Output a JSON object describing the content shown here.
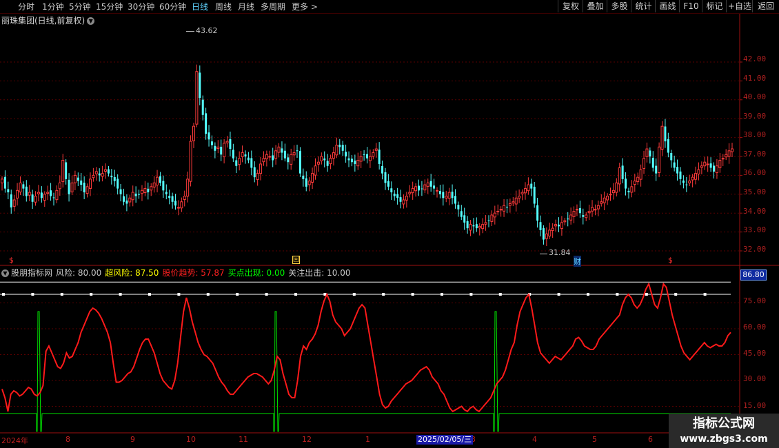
{
  "periods": [
    "分时",
    "1分钟",
    "5分钟",
    "15分钟",
    "30分钟",
    "60分钟",
    "日线",
    "周线",
    "月线",
    "多周期",
    "更多 >"
  ],
  "active_period": "日线",
  "toolbar": [
    "复权",
    "叠加",
    "多股",
    "统计",
    "画线",
    "F10",
    "标记",
    "+自选",
    "返回"
  ],
  "stock_title": "丽珠集团(日线,前复权)",
  "price_axis": [
    "42.00",
    "41.00",
    "40.00",
    "39.00",
    "38.00",
    "37.00",
    "36.00",
    "35.00",
    "34.00",
    "33.00",
    "32.00"
  ],
  "markers": {
    "high": "43.62",
    "low": "31.84",
    "s_glyph": "$",
    "cai": "财",
    "hui": "回"
  },
  "indicator": {
    "name": "股朋指标网",
    "items": [
      {
        "label": "风险: 80.00",
        "color": "#c8c8c8"
      },
      {
        "label": "超风险: 87.50",
        "color": "#ffff00"
      },
      {
        "label": "股价趋势: 57.87",
        "color": "#ff2020"
      },
      {
        "label": "买点出现: 0.00",
        "color": "#00ff00"
      },
      {
        "label": "关注出击: 10.00",
        "color": "#c8c8c8"
      }
    ],
    "current_value": "86.80"
  },
  "indicator_axis": [
    "75.00",
    "60.00",
    "45.00",
    "30.00",
    "15.00"
  ],
  "month_labels": [
    "2024年",
    "8",
    "9",
    "10",
    "11",
    "12",
    "1",
    "3",
    "4",
    "5",
    "6"
  ],
  "selected_date": "2025/02/05/三",
  "watermark": {
    "line1": "指标公式网",
    "line2": "www.zbgs3.com"
  },
  "chart_data": [
    {
      "type": "candlestick",
      "title": "丽珠集团(日线,前复权)",
      "ylim": [
        31.5,
        43.8
      ],
      "annotations": [
        {
          "label": "43.62",
          "value": 43.62
        },
        {
          "label": "31.84",
          "value": 31.84
        }
      ],
      "close": [
        35.8,
        35.3,
        35.1,
        34.3,
        34.7,
        35.2,
        35.6,
        35.3,
        34.9,
        35.1,
        34.6,
        34.9,
        35.1,
        34.8,
        35.0,
        35.1,
        34.9,
        34.8,
        35.2,
        35.6,
        36.8,
        35.8,
        35.0,
        35.6,
        36.0,
        35.7,
        35.5,
        35.1,
        35.4,
        35.8,
        36.0,
        36.2,
        36.0,
        36.1,
        36.3,
        36.1,
        35.9,
        35.7,
        35.3,
        35.0,
        34.6,
        34.5,
        34.8,
        35.1,
        34.9,
        35.0,
        35.2,
        35.3,
        35.1,
        35.4,
        35.6,
        35.9,
        35.6,
        35.2,
        35.0,
        34.8,
        34.6,
        34.4,
        34.3,
        34.6,
        34.9,
        35.8,
        37.8,
        38.6,
        41.5,
        40.1,
        39.2,
        38.2,
        37.9,
        37.6,
        37.3,
        37.5,
        37.1,
        37.7,
        37.8,
        37.4,
        36.9,
        36.5,
        36.9,
        37.2,
        37.0,
        36.8,
        36.4,
        35.9,
        36.1,
        36.6,
        36.9,
        37.1,
        37.0,
        36.8,
        37.3,
        37.5,
        37.2,
        36.9,
        36.7,
        37.1,
        37.2,
        37.3,
        36.1,
        35.8,
        35.4,
        35.7,
        36.1,
        36.5,
        36.7,
        37.0,
        36.8,
        36.5,
        36.9,
        37.2,
        37.6,
        37.5,
        37.3,
        37.0,
        36.8,
        36.7,
        36.6,
        36.8,
        37.0,
        37.1,
        36.9,
        37.0,
        37.2,
        37.4,
        36.6,
        36.1,
        35.6,
        35.4,
        35.1,
        34.9,
        34.8,
        34.6,
        34.7,
        34.9,
        35.1,
        35.3,
        35.4,
        35.2,
        35.3,
        35.5,
        35.6,
        35.4,
        35.3,
        35.2,
        35.0,
        34.8,
        34.9,
        35.1,
        34.8,
        34.5,
        34.2,
        33.8,
        33.5,
        33.2,
        33.4,
        33.3,
        33.2,
        33.3,
        33.4,
        33.5,
        33.6,
        33.9,
        34.0,
        34.1,
        34.2,
        34.4,
        34.3,
        34.5,
        34.6,
        34.8,
        34.9,
        35.1,
        35.3,
        35.5,
        35.3,
        34.5,
        33.6,
        33.1,
        32.6,
        32.9,
        33.1,
        33.2,
        33.4,
        33.3,
        33.5,
        33.6,
        33.7,
        33.9,
        34.1,
        34.2,
        34.0,
        33.8,
        33.9,
        34.1,
        34.3,
        34.2,
        34.4,
        34.6,
        34.8,
        34.9,
        35.0,
        35.2,
        35.6,
        36.4,
        35.8,
        35.3,
        35.1,
        35.4,
        35.7,
        35.9,
        36.3,
        36.9,
        37.4,
        37.0,
        36.4,
        36.1,
        37.5,
        38.6,
        37.8,
        37.2,
        36.8,
        36.4,
        36.1,
        35.8,
        35.6,
        35.5,
        35.7,
        35.9,
        36.1,
        36.3,
        36.5,
        36.7,
        36.6,
        36.4,
        36.2,
        36.5,
        36.8,
        36.9,
        37.1,
        37.3,
        37.4
      ]
    },
    {
      "type": "line",
      "ylim": [
        0,
        100
      ],
      "series": [
        {
          "name": "风险",
          "color": "#ffffff",
          "values": [
            80
          ]
        },
        {
          "name": "超风险",
          "color": "#ffffff",
          "values": [
            87.5
          ]
        },
        {
          "name": "股价趋势",
          "color": "#ff1a1a",
          "values": [
            25,
            20,
            12,
            22,
            24,
            23,
            21,
            22,
            24,
            26,
            25,
            22,
            21,
            23,
            27,
            47,
            50,
            46,
            42,
            38,
            37,
            40,
            46,
            43,
            44,
            48,
            52,
            58,
            62,
            66,
            70,
            72,
            71,
            69,
            66,
            62,
            58,
            52,
            40,
            29,
            29,
            30,
            32,
            34,
            35,
            38,
            43,
            48,
            52,
            54,
            54,
            50,
            46,
            40,
            34,
            30,
            28,
            26,
            25,
            30,
            40,
            55,
            70,
            78,
            72,
            64,
            58,
            52,
            48,
            45,
            44,
            42,
            40,
            36,
            32,
            29,
            27,
            24,
            22,
            22,
            24,
            26,
            28,
            30,
            32,
            33,
            34,
            34,
            33,
            32,
            30,
            28,
            30,
            36,
            44,
            42,
            34,
            28,
            22,
            20,
            20,
            30,
            44,
            50,
            48,
            52,
            54,
            57,
            62,
            70,
            76,
            80,
            76,
            68,
            64,
            62,
            60,
            56,
            58,
            60,
            64,
            68,
            72,
            74,
            72,
            62,
            52,
            42,
            32,
            22,
            16,
            14,
            15,
            18,
            20,
            22,
            24,
            26,
            28,
            29,
            30,
            32,
            34,
            36,
            37,
            38,
            36,
            32,
            30,
            28,
            24,
            22,
            18,
            14,
            12,
            13,
            14,
            15,
            13,
            12,
            14,
            15,
            13,
            12,
            14,
            16,
            18,
            20,
            24,
            28,
            30,
            32,
            36,
            42,
            48,
            52,
            62,
            70,
            74,
            78,
            80,
            72,
            62,
            52,
            46,
            44,
            42,
            40,
            42,
            44,
            43,
            42,
            44,
            46,
            48,
            50,
            54,
            55,
            53,
            50,
            49,
            48,
            48,
            50,
            54,
            56,
            58,
            60,
            62,
            64,
            66,
            68,
            74,
            78,
            80,
            78,
            74,
            72,
            74,
            78,
            83,
            86,
            80,
            74,
            72,
            78,
            86,
            84,
            76,
            68,
            62,
            56,
            50,
            46,
            44,
            42,
            44,
            46,
            48,
            50,
            52,
            50,
            49,
            50,
            51,
            50,
            50,
            52,
            56,
            57.87
          ]
        },
        {
          "name": "买点出现",
          "color": "#00e000",
          "values": [
            0
          ]
        }
      ]
    }
  ]
}
